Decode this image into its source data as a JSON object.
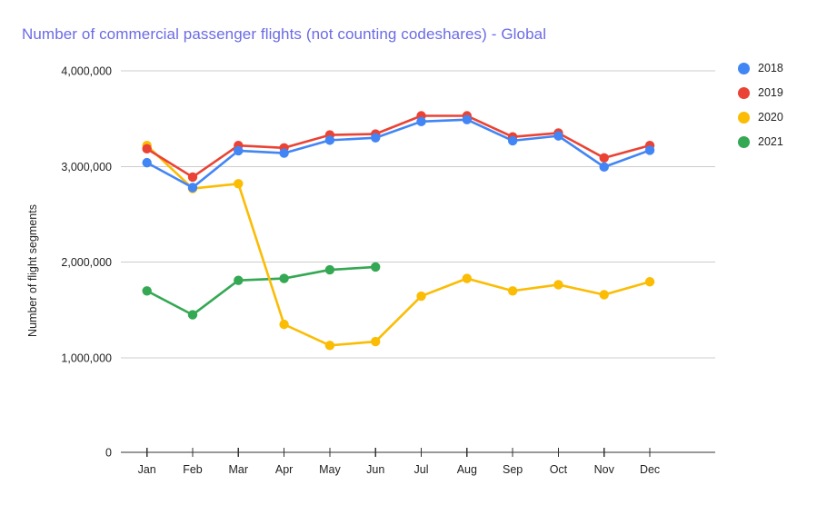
{
  "chart_data": {
    "type": "line",
    "title": "Number of commercial passenger flights (not counting codeshares) - Global",
    "xlabel": "",
    "ylabel": "Number of flight segments",
    "categories": [
      "Jan",
      "Feb",
      "Mar",
      "Apr",
      "May",
      "Jun",
      "Jul",
      "Aug",
      "Sep",
      "Oct",
      "Nov",
      "Dec"
    ],
    "ylim": [
      0,
      4000000
    ],
    "yticks": [
      0,
      1000000,
      2000000,
      3000000,
      4000000
    ],
    "ytick_labels": [
      "0",
      "1,000,000",
      "2,000,000",
      "3,000,000",
      "4,000,000"
    ],
    "grid": true,
    "legend_position": "right",
    "markers": true,
    "series": [
      {
        "name": "2018",
        "color": "#4285f4",
        "values": [
          3040000,
          2780000,
          3165000,
          3140000,
          3275000,
          3300000,
          3470000,
          3490000,
          3270000,
          3320000,
          2995000,
          3170000
        ]
      },
      {
        "name": "2019",
        "color": "#ea4335",
        "values": [
          3185000,
          2890000,
          3220000,
          3195000,
          3330000,
          3340000,
          3530000,
          3530000,
          3310000,
          3350000,
          3090000,
          3220000
        ]
      },
      {
        "name": "2020",
        "color": "#fbbc04",
        "values": [
          3220000,
          2770000,
          2820000,
          1350000,
          1130000,
          1170000,
          1645000,
          1830000,
          1700000,
          1765000,
          1660000,
          1795000
        ]
      },
      {
        "name": "2021",
        "color": "#34a853",
        "values": [
          1700000,
          1450000,
          1810000,
          1830000,
          1920000,
          1950000,
          null,
          null,
          null,
          null,
          null,
          null
        ]
      }
    ]
  },
  "legend": {
    "items": [
      {
        "label": "2018",
        "color": "#4285f4"
      },
      {
        "label": "2019",
        "color": "#ea4335"
      },
      {
        "label": "2020",
        "color": "#fbbc04"
      },
      {
        "label": "2021",
        "color": "#34a853"
      }
    ]
  }
}
